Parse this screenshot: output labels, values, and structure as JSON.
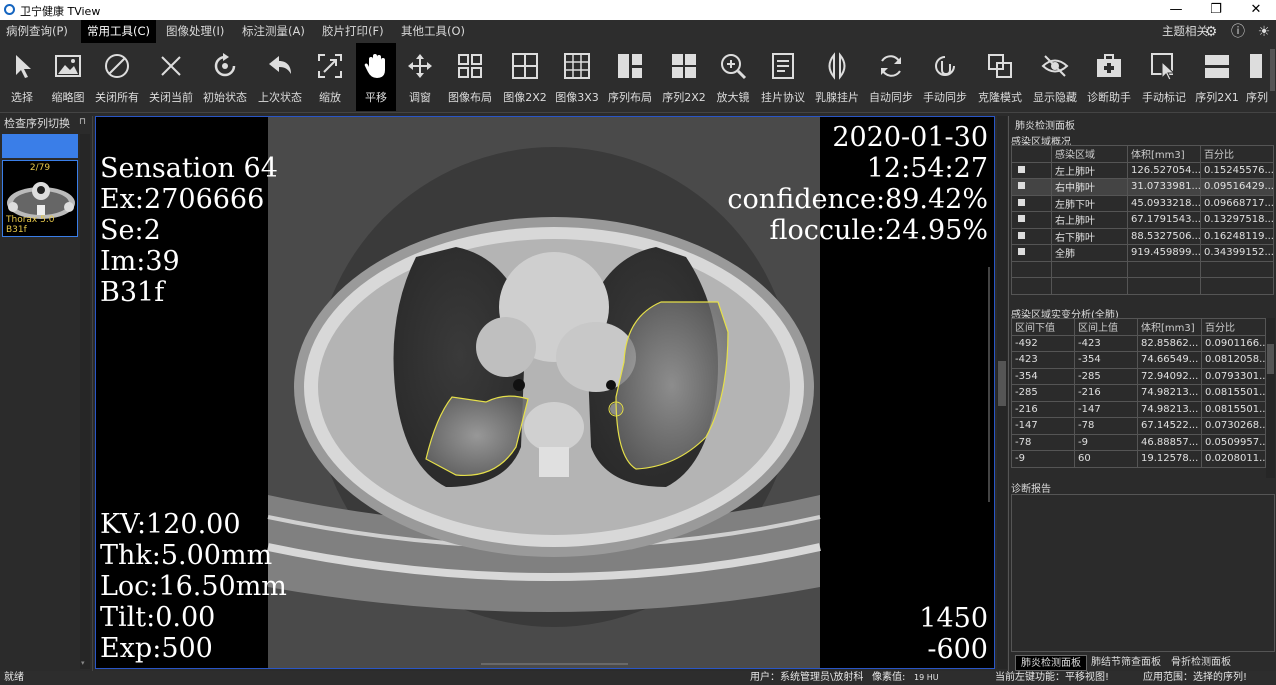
{
  "window": {
    "title": "卫宁健康 TView"
  },
  "menu": {
    "items": [
      "病例查询(P)",
      "常用工具(C)",
      "图像处理(I)",
      "标注测量(A)",
      "胶片打印(F)",
      "其他工具(O)"
    ],
    "theme_label": "主题相关"
  },
  "toolbar": {
    "tools": [
      "选择",
      "缩略图",
      "关闭所有",
      "关闭当前",
      "初始状态",
      "上次状态",
      "缩放",
      "平移",
      "调窗",
      "图像布局",
      "图像2X2",
      "图像3X3",
      "序列布局",
      "序列2X2",
      "放大镜",
      "挂片协议",
      "乳腺挂片",
      "自动同步",
      "手动同步",
      "克隆模式",
      "显示隐藏",
      "诊断助手",
      "手动标记",
      "序列2X1",
      "序列"
    ]
  },
  "left_panel": {
    "title": "检查序列切换",
    "thumb_count": "2/79",
    "thumb_name": "Thorax  5.0  B31f"
  },
  "viewer": {
    "top_left": [
      "Sensation 64",
      "Ex:2706666",
      "Se:2",
      "Im:39",
      "B31f"
    ],
    "top_right": [
      "2020-01-30",
      "12:54:27",
      "confidence:89.42%",
      "floccule:24.95%"
    ],
    "bottom_left": [
      "KV:120.00",
      "Thk:5.00mm",
      "Loc:16.50mm",
      "Tilt:0.00",
      "Exp:500"
    ],
    "bottom_right": [
      "1450",
      "-600"
    ]
  },
  "right_panel": {
    "title": "肺炎检测面板",
    "overview": {
      "title": "感染区域概况",
      "headers": [
        "感染区域",
        "体积[mm3]",
        "百分比"
      ],
      "rows": [
        [
          "左上肺叶",
          "126.527054...",
          "0.15245576..."
        ],
        [
          "右中肺叶",
          "31.0733981...",
          "0.09516429..."
        ],
        [
          "左肺下叶",
          "45.0933218...",
          "0.09668717..."
        ],
        [
          "右上肺叶",
          "67.1791543...",
          "0.13297518..."
        ],
        [
          "右下肺叶",
          "88.5327506...",
          "0.16248119..."
        ],
        [
          "全肺",
          "919.459899...",
          "0.34399152..."
        ]
      ]
    },
    "density": {
      "title": "感染区域实变分析(全肺)",
      "headers": [
        "区间下值",
        "区间上值",
        "体积[mm3]",
        "百分比"
      ],
      "rows": [
        [
          "-492",
          "-423",
          "82.85862...",
          "0.0901166..."
        ],
        [
          "-423",
          "-354",
          "74.66549...",
          "0.0812058..."
        ],
        [
          "-354",
          "-285",
          "72.94092...",
          "0.0793301..."
        ],
        [
          "-285",
          "-216",
          "74.98213...",
          "0.0815501..."
        ],
        [
          "-216",
          "-147",
          "74.98213...",
          "0.0815501..."
        ],
        [
          "-147",
          "-78",
          "67.14522...",
          "0.0730268..."
        ],
        [
          "-78",
          "-9",
          "46.88857...",
          "0.0509957..."
        ],
        [
          "-9",
          "60",
          "19.12578...",
          "0.0208011..."
        ]
      ]
    },
    "report": {
      "title": "诊断报告"
    },
    "tabs": [
      "肺炎检测面板",
      "肺结节筛查面板",
      "骨折检测面板"
    ]
  },
  "status": {
    "left": "就绪",
    "user": "用户：系统管理员\\放射科",
    "pixel_label": "像素值:",
    "pixel_value": "19 HU",
    "function": "当前左键功能：平移视图!",
    "scope": "应用范围：选择的序列!"
  }
}
